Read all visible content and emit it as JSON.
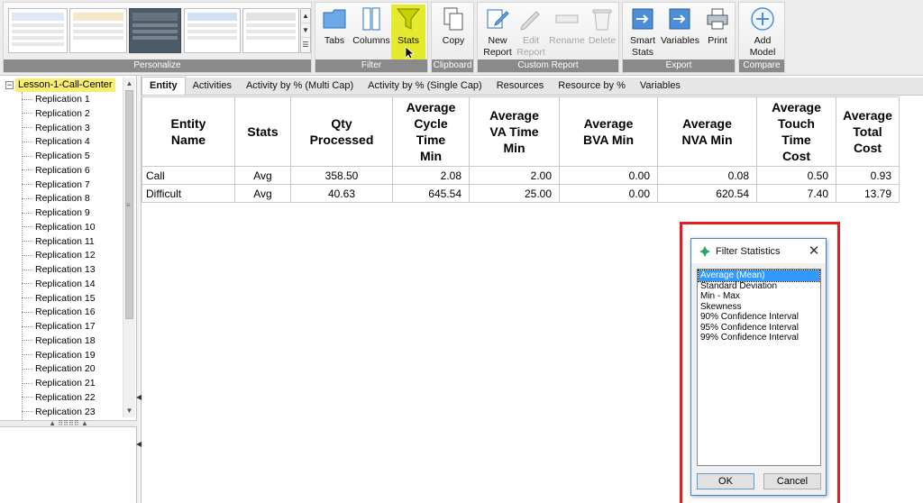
{
  "ribbon": {
    "groups": {
      "personalize": "Personalize",
      "filter": "Filter",
      "clipboard": "Clipboard",
      "custom_report": "Custom Report",
      "export": "Export",
      "compare": "Compare"
    },
    "buttons": {
      "tabs": "Tabs",
      "columns": "Columns",
      "stats": "Stats",
      "copy": "Copy",
      "new_report_1": "New",
      "new_report_2": "Report",
      "edit_report_1": "Edit",
      "edit_report_2": "Report",
      "rename": "Rename",
      "delete": "Delete",
      "smart_stats_1": "Smart",
      "smart_stats_2": "Stats",
      "variables": "Variables",
      "print": "Print",
      "add_model_1": "Add",
      "add_model_2": "Model"
    },
    "highlight_color": "#e6ea2e"
  },
  "tree": {
    "root": "Lesson-1-Call-Center",
    "items": [
      "Replication 1",
      "Replication 2",
      "Replication 3",
      "Replication 4",
      "Replication 5",
      "Replication 6",
      "Replication 7",
      "Replication 8",
      "Replication 9",
      "Replication 10",
      "Replication 11",
      "Replication 12",
      "Replication 13",
      "Replication 14",
      "Replication 15",
      "Replication 16",
      "Replication 17",
      "Replication 18",
      "Replication 19",
      "Replication 20",
      "Replication 21",
      "Replication 22",
      "Replication 23"
    ]
  },
  "tabs": [
    "Entity",
    "Activities",
    "Activity by % (Multi Cap)",
    "Activity by % (Single Cap)",
    "Resources",
    "Resource by %",
    "Variables"
  ],
  "table": {
    "headers": [
      [
        "Entity",
        "Name"
      ],
      [
        "Stats"
      ],
      [
        "Qty",
        "Processed"
      ],
      [
        "Average",
        "Cycle",
        "Time",
        "Min"
      ],
      [
        "Average",
        "VA Time",
        "Min"
      ],
      [
        "Average",
        "BVA Min"
      ],
      [
        "Average",
        "NVA Min"
      ],
      [
        "Average",
        "Touch",
        "Time",
        "Cost"
      ],
      [
        "Average",
        "Total",
        "Cost"
      ]
    ],
    "rows": [
      [
        "Call",
        "Avg",
        "358.50",
        "2.08",
        "2.00",
        "0.00",
        "0.08",
        "0.50",
        "0.93"
      ],
      [
        "Difficult",
        "Avg",
        "40.63",
        "645.54",
        "25.00",
        "0.00",
        "620.54",
        "7.40",
        "13.79"
      ]
    ]
  },
  "dialog": {
    "title": "Filter Statistics",
    "close": "✕",
    "options": [
      "Average (Mean)",
      "Standard Deviation",
      "Min - Max",
      "Skewness",
      "90% Confidence Interval",
      "95% Confidence Interval",
      "99% Confidence Interval"
    ],
    "selected_index": 0,
    "ok": "OK",
    "cancel": "Cancel",
    "highlight_border_color": "#e02020"
  }
}
